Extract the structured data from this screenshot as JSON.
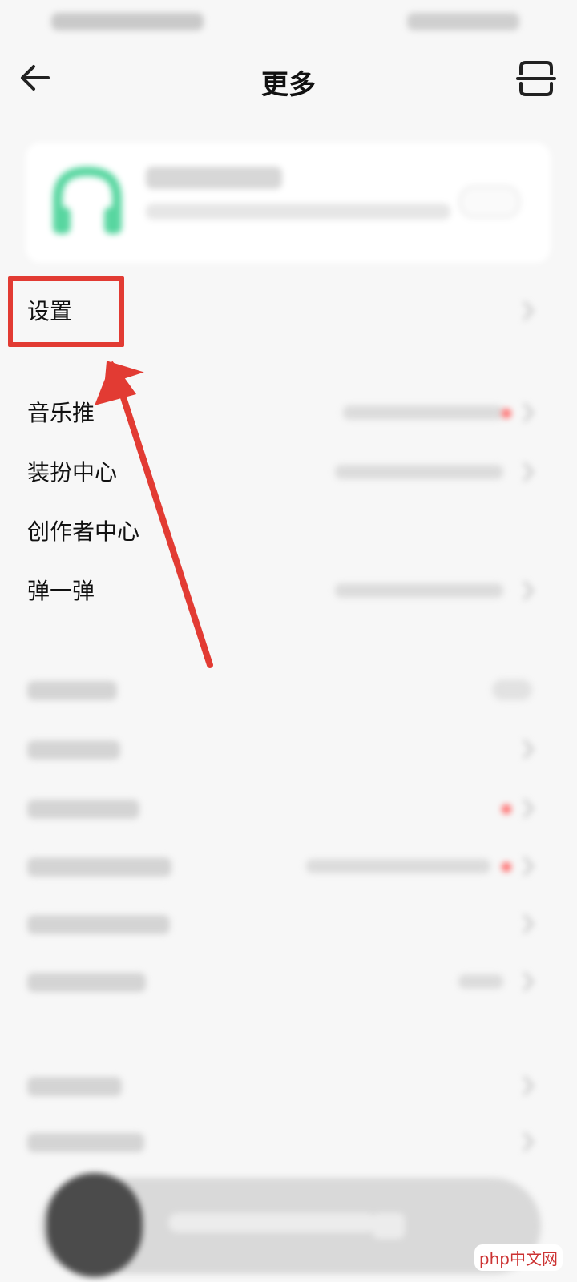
{
  "header": {
    "title": "更多"
  },
  "menu": {
    "settings": "设置",
    "items": [
      {
        "label": "音乐推"
      },
      {
        "label": "装扮中心"
      },
      {
        "label": "创作者中心"
      },
      {
        "label": "弹一弹"
      }
    ]
  },
  "watermark": "php中文网",
  "colors": {
    "highlight": "#e23b33",
    "accent_green": "#58d6a0",
    "badge_red": "#ff6a6a"
  }
}
